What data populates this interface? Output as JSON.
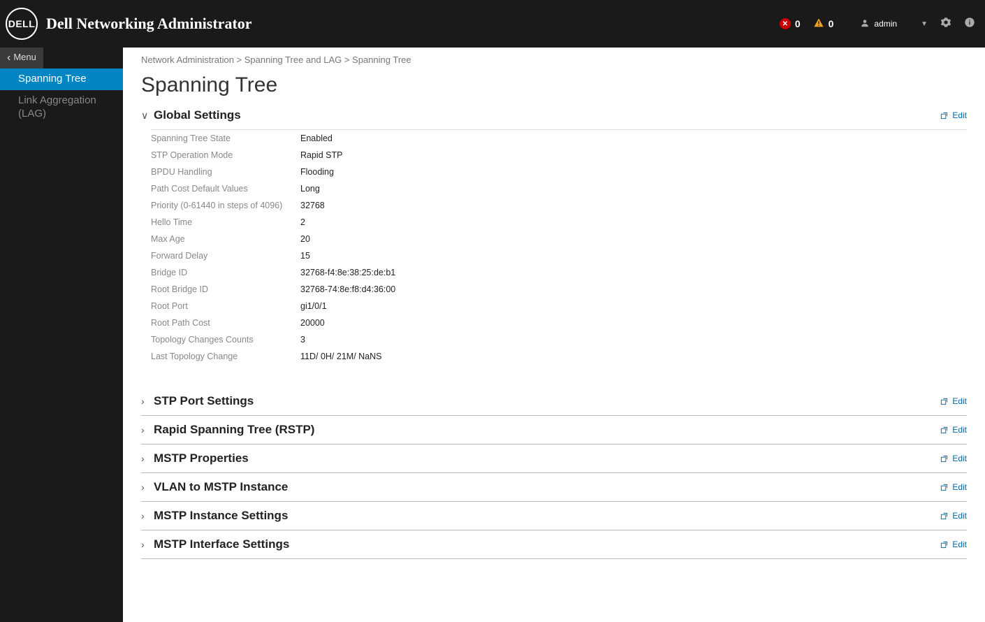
{
  "header": {
    "brand": "DELL",
    "app_title": "Dell Networking Administrator",
    "error_count": "0",
    "warn_count": "0",
    "user_label": "admin"
  },
  "sidebar": {
    "menu_label": "Menu",
    "items": [
      {
        "label": "Spanning Tree",
        "active": true
      },
      {
        "label": "Link Aggregation (LAG)",
        "active": false
      }
    ]
  },
  "breadcrumb": "Network Administration > Spanning Tree and LAG > Spanning Tree",
  "page_title": "Spanning Tree",
  "edit_label": "Edit",
  "global_settings": {
    "title": "Global Settings",
    "rows": [
      {
        "label": "Spanning Tree State",
        "value": "Enabled"
      },
      {
        "label": "STP Operation Mode",
        "value": "Rapid STP"
      },
      {
        "label": "BPDU Handling",
        "value": "Flooding"
      },
      {
        "label": "Path Cost Default Values",
        "value": "Long"
      },
      {
        "label": "Priority (0-61440 in steps of 4096)",
        "value": "32768"
      },
      {
        "label": "Hello Time",
        "value": "2"
      },
      {
        "label": "Max Age",
        "value": "20"
      },
      {
        "label": "Forward Delay",
        "value": "15"
      },
      {
        "label": "Bridge ID",
        "value": "32768-f4:8e:38:25:de:b1"
      },
      {
        "label": "Root Bridge ID",
        "value": "32768-74:8e:f8:d4:36:00"
      },
      {
        "label": "Root Port",
        "value": "gi1/0/1"
      },
      {
        "label": "Root Path Cost",
        "value": "20000"
      },
      {
        "label": "Topology Changes Counts",
        "value": "3"
      },
      {
        "label": "Last Topology Change",
        "value": "11D/ 0H/ 21M/ NaNS"
      }
    ]
  },
  "collapsed_sections": [
    {
      "title": "STP Port Settings"
    },
    {
      "title": "Rapid Spanning Tree (RSTP)"
    },
    {
      "title": "MSTP Properties"
    },
    {
      "title": "VLAN to MSTP Instance"
    },
    {
      "title": "MSTP Instance Settings"
    },
    {
      "title": "MSTP Interface Settings"
    }
  ]
}
